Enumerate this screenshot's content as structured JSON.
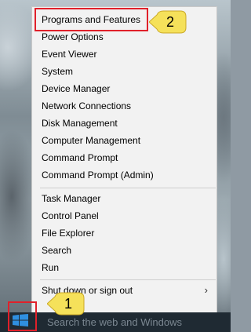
{
  "menu": {
    "items": [
      {
        "label": "Programs and Features"
      },
      {
        "label": "Power Options"
      },
      {
        "label": "Event Viewer"
      },
      {
        "label": "System"
      },
      {
        "label": "Device Manager"
      },
      {
        "label": "Network Connections"
      },
      {
        "label": "Disk Management"
      },
      {
        "label": "Computer Management"
      },
      {
        "label": "Command Prompt"
      },
      {
        "label": "Command Prompt (Admin)"
      },
      {
        "label": "Task Manager"
      },
      {
        "label": "Control Panel"
      },
      {
        "label": "File Explorer"
      },
      {
        "label": "Search"
      },
      {
        "label": "Run"
      },
      {
        "label": "Shut down or sign out"
      }
    ]
  },
  "callouts": {
    "step1": "1",
    "step2": "2"
  },
  "taskbar": {
    "search_text": "Search the web and Windows"
  },
  "colors": {
    "highlight": "#e0202a",
    "callout_fill": "#f5e15a",
    "taskbar": "#1f2a33"
  },
  "icons": {
    "start": "windows-logo-icon",
    "submenu": "chevron-right-icon"
  }
}
